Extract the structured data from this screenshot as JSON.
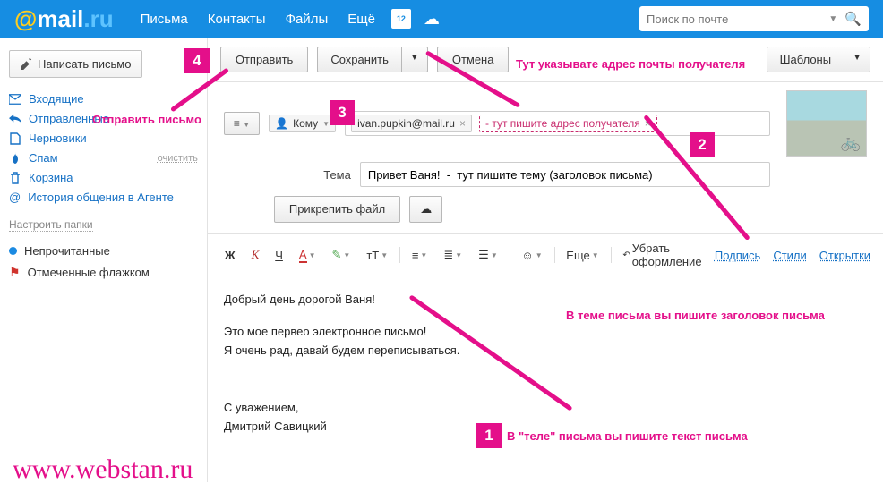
{
  "header": {
    "calendar_day": "12",
    "nav": [
      "Письма",
      "Контакты",
      "Файлы",
      "Ещё"
    ],
    "search_placeholder": "Поиск по почте"
  },
  "sidebar": {
    "compose": "Написать письмо",
    "folders": {
      "inbox": "Входящие",
      "sent": "Отправленные",
      "drafts": "Черновики",
      "spam": "Спам",
      "trash": "Корзина",
      "chat_history": "История общения в Агенте",
      "clear": "очистить"
    },
    "setup": "Настроить папки",
    "filters": {
      "unread": "Непрочитанные",
      "flagged": "Отмеченные флажком"
    }
  },
  "compose": {
    "send": "Отправить",
    "save": "Сохранить",
    "cancel": "Отмена",
    "templates": "Шаблоны",
    "to_label": "Кому",
    "to_value": "ivan.pupkin@mail.ru",
    "to_hint": "- тут пишите адрес получателя",
    "subject_label": "Тема",
    "subject_value": "Привет Ваня!  -  тут пишите тему (заголовок письма)",
    "attach": "Прикрепить файл",
    "list_collapse": "≡"
  },
  "formatbar": {
    "bold": "Ж",
    "italic": "К",
    "underline": "Ч",
    "letterA": "A",
    "tt": "тT",
    "more": "Еще",
    "removeFmt": "Убрать оформление",
    "signature": "Подпись",
    "styles": "Стили",
    "cards": "Открытки"
  },
  "body": {
    "l1": "Добрый день дорогой Ваня!",
    "l2": "Это мое первео электронное письмо!",
    "l3": "Я очень рад, давай будем переписываться.",
    "l4": "С уважением,",
    "l5": "Дмитрий Савицкий"
  },
  "annotations": {
    "n1": "1",
    "n2": "2",
    "n3": "3",
    "n4": "4",
    "send_letter": "Отправить письмо",
    "addr_hint": "Тут указывате адрес почты получателя",
    "subject_hint": "В теме письма вы пишите заголовок письма",
    "body_hint": "В \"теле\" письма вы пишите текст письма",
    "site": "www.webstan.ru"
  }
}
